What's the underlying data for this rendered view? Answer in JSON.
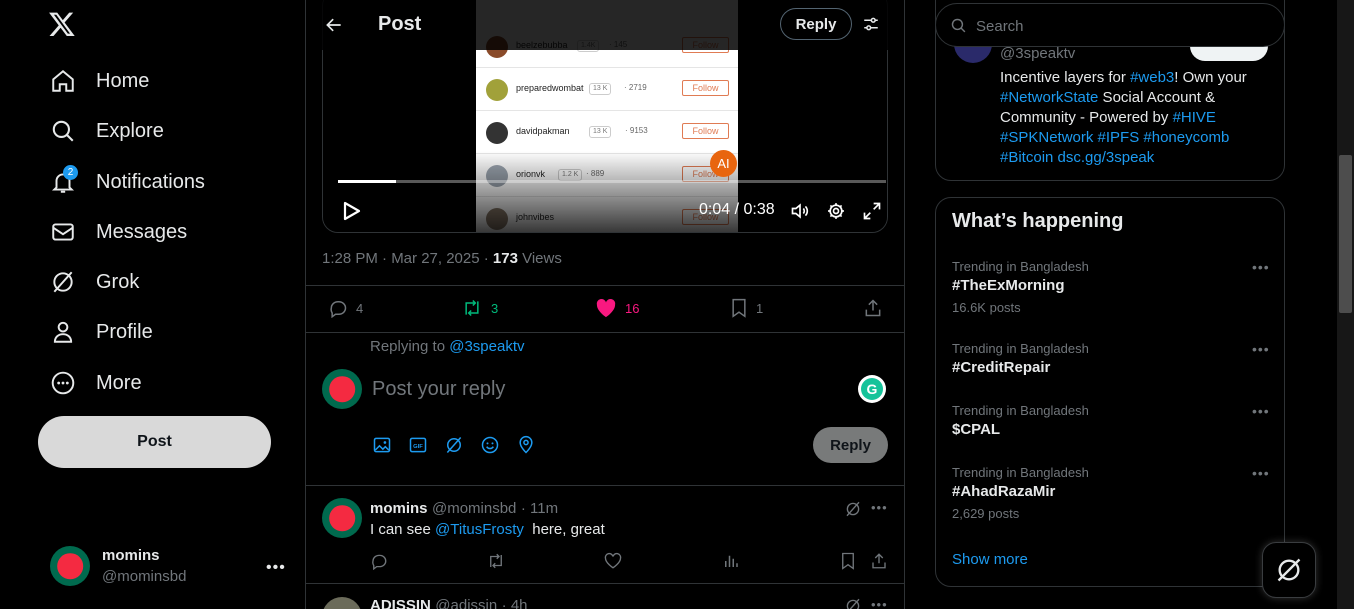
{
  "nav": {
    "items": [
      {
        "label": "Home",
        "icon": "home-icon"
      },
      {
        "label": "Explore",
        "icon": "search-icon"
      },
      {
        "label": "Notifications",
        "icon": "bell-icon",
        "badge": "2"
      },
      {
        "label": "Messages",
        "icon": "mail-icon"
      },
      {
        "label": "Grok",
        "icon": "grok-icon"
      },
      {
        "label": "Profile",
        "icon": "person-icon"
      },
      {
        "label": "More",
        "icon": "more-circle-icon"
      }
    ],
    "post_label": "Post"
  },
  "account": {
    "name": "momins",
    "handle": "@mominsbd"
  },
  "header": {
    "title": "Post",
    "reply_label": "Reply"
  },
  "video": {
    "rows": [
      {
        "name": "beelzebubba",
        "chip": "1.4K",
        "count": "· 145",
        "follow": "Follow",
        "color": "#8a4b2a"
      },
      {
        "name": "preparedwombat",
        "chip": "13 K",
        "count": "· 2719",
        "follow": "Follow",
        "color": "#a1a13a"
      },
      {
        "name": "davidpakman",
        "chip": "13 K",
        "count": "· 9153",
        "follow": "Follow",
        "color": "#333333"
      },
      {
        "name": "orionvk",
        "chip": "1.2 K",
        "count": "· 889",
        "follow": "Follow",
        "color": "#9aa3ad"
      },
      {
        "name": "johnvibes",
        "chip": "",
        "count": "",
        "follow": "Follow",
        "color": "#8a7a6a"
      }
    ],
    "ai_badge": "AI",
    "current_time": "0:04",
    "separator": "/",
    "duration": "0:38",
    "progress": 0.105
  },
  "post_meta": {
    "time": "1:28 PM · Mar 27, 2025 · ",
    "views_count": "173",
    "views_label": " Views"
  },
  "stats": {
    "replies": "4",
    "reposts": "3",
    "likes": "16",
    "bookmarks": "1"
  },
  "reply_box": {
    "replying_prefix": "Replying to ",
    "replying_handle": "@3speaktv",
    "placeholder": "Post your reply",
    "button": "Reply"
  },
  "reply_tweet": {
    "name": "momins",
    "handle": "@mominsbd",
    "time": "· 11m",
    "text_before": "I can see ",
    "mention": "@TitusFrosty",
    "text_after": "  here, great"
  },
  "next_tweet": {
    "name": "ADISSIN",
    "handle": "@adissin",
    "time": "· 4h"
  },
  "search": {
    "placeholder": "Search"
  },
  "profile_card": {
    "handle": "@3speaktv",
    "bio": [
      {
        "t": "Incentive layers for ",
        "link": false
      },
      {
        "t": "#web3",
        "link": true
      },
      {
        "t": "! Own your ",
        "link": false
      },
      {
        "t": "#NetworkState",
        "link": true
      },
      {
        "t": " Social Account & Community - Powered by ",
        "link": false
      },
      {
        "t": "#HIVE",
        "link": true
      },
      {
        "t": " ",
        "link": false
      },
      {
        "t": "#SPKNetwork",
        "link": true
      },
      {
        "t": " ",
        "link": false
      },
      {
        "t": "#IPFS",
        "link": true
      },
      {
        "t": " ",
        "link": false
      },
      {
        "t": "#honeycomb",
        "link": true
      },
      {
        "t": " ",
        "link": false
      },
      {
        "t": "#Bitcoin",
        "link": true
      },
      {
        "t": " ",
        "link": false
      },
      {
        "t": "dsc.gg/3speak",
        "link": true
      }
    ]
  },
  "trends": {
    "title": "What’s happening",
    "items": [
      {
        "context": "Trending in Bangladesh",
        "topic": "#TheExMorning",
        "posts": "16.6K posts"
      },
      {
        "context": "Trending in Bangladesh",
        "topic": "#CreditRepair",
        "posts": ""
      },
      {
        "context": "Trending in Bangladesh",
        "topic": "$CPAL",
        "posts": ""
      },
      {
        "context": "Trending in Bangladesh",
        "topic": "#AhadRazaMir",
        "posts": "2,629 posts"
      }
    ],
    "show_more": "Show more"
  },
  "colors": {
    "accent": "#1d9bf0",
    "like": "#f91880",
    "repost": "#00ba7c",
    "bg": "#000000",
    "border": "#2f3336"
  }
}
